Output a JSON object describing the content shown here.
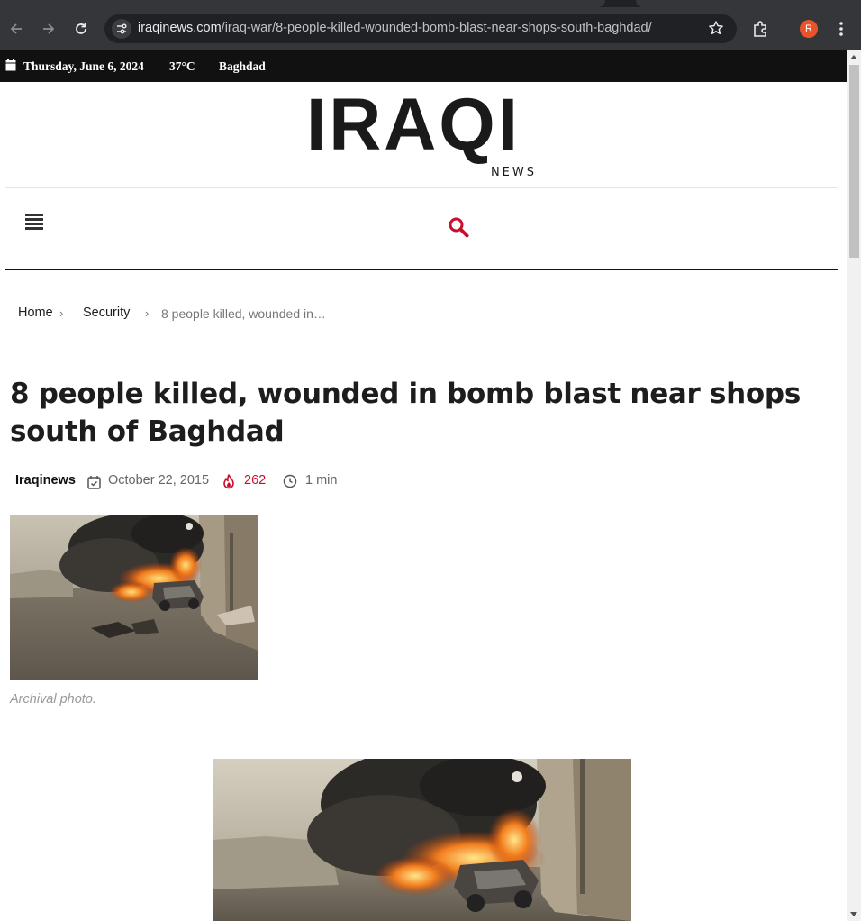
{
  "browser": {
    "url_domain": "iraqinews.com",
    "url_path": "/iraq-war/8-people-killed-wounded-bomb-blast-near-shops-south-baghdad/",
    "profile_initial": "R",
    "icons": [
      "back-icon",
      "forward-icon",
      "reload-icon",
      "site-info-icon",
      "bookmark-star-icon",
      "extensions-icon",
      "kebab-menu-icon"
    ]
  },
  "topbar": {
    "date": "Thursday, June 6, 2024",
    "temperature": "37°C",
    "city": "Baghdad"
  },
  "logo": {
    "word": "IRAQI",
    "sub": "NEWS"
  },
  "breadcrumb": {
    "home": "Home",
    "section": "Security",
    "current": "8 people killed, wounded in…"
  },
  "article": {
    "title": "8 people killed, wounded in bomb blast near shops south of Baghdad",
    "author": "Iraqinews",
    "date": "October 22, 2015",
    "views": "262",
    "read_time": "1 min",
    "caption": "Archival photo."
  },
  "colors": {
    "accent": "#c8102e",
    "topbar_bg": "#111111",
    "chrome_toolbar": "#35363a"
  }
}
